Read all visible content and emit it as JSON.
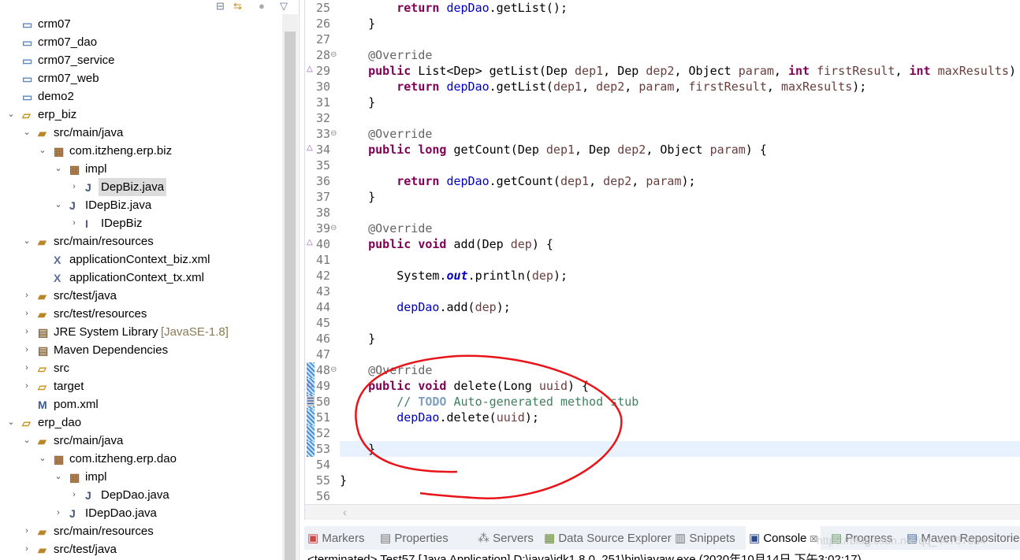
{
  "explorer": {
    "toolbar": {
      "collapse_icon": "collapse-all-icon",
      "link_icon": "link-with-editor-icon",
      "menu_icon": "view-menu-icon"
    },
    "items": [
      {
        "label": "crm07",
        "icon": "folder",
        "depth": 0,
        "chev": ""
      },
      {
        "label": "crm07_dao",
        "icon": "folder",
        "depth": 0,
        "chev": ""
      },
      {
        "label": "crm07_service",
        "icon": "folder",
        "depth": 0,
        "chev": ""
      },
      {
        "label": "crm07_web",
        "icon": "folder",
        "depth": 0,
        "chev": ""
      },
      {
        "label": "demo2",
        "icon": "folder",
        "depth": 0,
        "chev": ""
      },
      {
        "label": "erp_biz",
        "icon": "maven-project",
        "depth": 0,
        "chev": "open"
      },
      {
        "label": "src/main/java",
        "icon": "source-folder",
        "depth": 1,
        "chev": "open"
      },
      {
        "label": "com.itzheng.erp.biz",
        "icon": "package",
        "depth": 2,
        "chev": "open"
      },
      {
        "label": "impl",
        "icon": "package",
        "depth": 3,
        "chev": "open"
      },
      {
        "label": "DepBiz.java",
        "icon": "java-file",
        "depth": 4,
        "chev": "closed",
        "selected": true
      },
      {
        "label": "IDepBiz.java",
        "icon": "java-file",
        "depth": 3,
        "chev": "open"
      },
      {
        "label": "IDepBiz",
        "icon": "interface",
        "depth": 4,
        "chev": "closed"
      },
      {
        "label": "src/main/resources",
        "icon": "source-folder",
        "depth": 1,
        "chev": "open"
      },
      {
        "label": "applicationContext_biz.xml",
        "icon": "xml-file",
        "depth": 2,
        "chev": ""
      },
      {
        "label": "applicationContext_tx.xml",
        "icon": "xml-file",
        "depth": 2,
        "chev": ""
      },
      {
        "label": "src/test/java",
        "icon": "source-folder",
        "depth": 1,
        "chev": "closed"
      },
      {
        "label": "src/test/resources",
        "icon": "source-folder",
        "depth": 1,
        "chev": "closed"
      },
      {
        "label": "JRE System Library",
        "deco": "[JavaSE-1.8]",
        "icon": "library",
        "depth": 1,
        "chev": "closed"
      },
      {
        "label": "Maven Dependencies",
        "icon": "library",
        "depth": 1,
        "chev": "closed"
      },
      {
        "label": "src",
        "icon": "folder-open",
        "depth": 1,
        "chev": "closed"
      },
      {
        "label": "target",
        "icon": "folder-open",
        "depth": 1,
        "chev": "closed"
      },
      {
        "label": "pom.xml",
        "icon": "pom-file",
        "depth": 1,
        "chev": ""
      },
      {
        "label": "erp_dao",
        "icon": "maven-project",
        "depth": 0,
        "chev": "open"
      },
      {
        "label": "src/main/java",
        "icon": "source-folder",
        "depth": 1,
        "chev": "open"
      },
      {
        "label": "com.itzheng.erp.dao",
        "icon": "package",
        "depth": 2,
        "chev": "open"
      },
      {
        "label": "impl",
        "icon": "package",
        "depth": 3,
        "chev": "open"
      },
      {
        "label": "DepDao.java",
        "icon": "java-file",
        "depth": 4,
        "chev": "closed"
      },
      {
        "label": "IDepDao.java",
        "icon": "java-file",
        "depth": 3,
        "chev": "closed"
      },
      {
        "label": "src/main/resources",
        "icon": "source-folder",
        "depth": 1,
        "chev": "closed"
      },
      {
        "label": "src/test/java",
        "icon": "source-folder",
        "depth": 1,
        "chev": "closed"
      }
    ]
  },
  "editor": {
    "current_line": 53,
    "lines": [
      {
        "n": "25",
        "tokens": [
          [
            "        ",
            ""
          ],
          [
            "return",
            "k"
          ],
          [
            " ",
            ""
          ],
          [
            "depDao",
            "f"
          ],
          [
            ".getList();",
            ""
          ]
        ]
      },
      {
        "n": "26",
        "tokens": [
          [
            "    }",
            ""
          ]
        ]
      },
      {
        "n": "27",
        "tokens": []
      },
      {
        "n": "28",
        "fold": true,
        "tokens": [
          [
            "    ",
            ""
          ],
          [
            "@Override",
            "a"
          ]
        ]
      },
      {
        "n": "29",
        "override": true,
        "tokens": [
          [
            "    ",
            ""
          ],
          [
            "public",
            "k"
          ],
          [
            " List<Dep> getList(Dep ",
            ""
          ],
          [
            "dep1",
            "p"
          ],
          [
            ", Dep ",
            ""
          ],
          [
            "dep2",
            "p"
          ],
          [
            ", Object ",
            ""
          ],
          [
            "param",
            "p"
          ],
          [
            ", ",
            ""
          ],
          [
            "int",
            "k"
          ],
          [
            " ",
            ""
          ],
          [
            "firstResult",
            "p"
          ],
          [
            ", ",
            ""
          ],
          [
            "int",
            "k"
          ],
          [
            " ",
            ""
          ],
          [
            "maxResults",
            "p"
          ],
          [
            ")",
            ""
          ]
        ]
      },
      {
        "n": "30",
        "tokens": [
          [
            "        ",
            ""
          ],
          [
            "return",
            "k"
          ],
          [
            " ",
            ""
          ],
          [
            "depDao",
            "f"
          ],
          [
            ".getList(",
            ""
          ],
          [
            "dep1",
            "p"
          ],
          [
            ", ",
            ""
          ],
          [
            "dep2",
            "p"
          ],
          [
            ", ",
            ""
          ],
          [
            "param",
            "p"
          ],
          [
            ", ",
            ""
          ],
          [
            "firstResult",
            "p"
          ],
          [
            ", ",
            ""
          ],
          [
            "maxResults",
            "p"
          ],
          [
            ");",
            ""
          ]
        ]
      },
      {
        "n": "31",
        "tokens": [
          [
            "    }",
            ""
          ]
        ]
      },
      {
        "n": "32",
        "tokens": []
      },
      {
        "n": "33",
        "fold": true,
        "tokens": [
          [
            "    ",
            ""
          ],
          [
            "@Override",
            "a"
          ]
        ]
      },
      {
        "n": "34",
        "override": true,
        "tokens": [
          [
            "    ",
            ""
          ],
          [
            "public",
            "k"
          ],
          [
            " ",
            ""
          ],
          [
            "long",
            "k"
          ],
          [
            " getCount(Dep ",
            ""
          ],
          [
            "dep1",
            "p"
          ],
          [
            ", Dep ",
            ""
          ],
          [
            "dep2",
            "p"
          ],
          [
            ", Object ",
            ""
          ],
          [
            "param",
            "p"
          ],
          [
            ") {",
            ""
          ]
        ]
      },
      {
        "n": "35",
        "tokens": []
      },
      {
        "n": "36",
        "tokens": [
          [
            "        ",
            ""
          ],
          [
            "return",
            "k"
          ],
          [
            " ",
            ""
          ],
          [
            "depDao",
            "f"
          ],
          [
            ".getCount(",
            ""
          ],
          [
            "dep1",
            "p"
          ],
          [
            ", ",
            ""
          ],
          [
            "dep2",
            "p"
          ],
          [
            ", ",
            ""
          ],
          [
            "param",
            "p"
          ],
          [
            ");",
            ""
          ]
        ]
      },
      {
        "n": "37",
        "tokens": [
          [
            "    }",
            ""
          ]
        ]
      },
      {
        "n": "38",
        "tokens": []
      },
      {
        "n": "39",
        "fold": true,
        "tokens": [
          [
            "    ",
            ""
          ],
          [
            "@Override",
            "a"
          ]
        ]
      },
      {
        "n": "40",
        "override": true,
        "tokens": [
          [
            "    ",
            ""
          ],
          [
            "public",
            "k"
          ],
          [
            " ",
            ""
          ],
          [
            "void",
            "k"
          ],
          [
            " add(Dep ",
            ""
          ],
          [
            "dep",
            "p"
          ],
          [
            ") {",
            ""
          ]
        ]
      },
      {
        "n": "41",
        "tokens": []
      },
      {
        "n": "42",
        "tokens": [
          [
            "        System.",
            ""
          ],
          [
            "out",
            "s"
          ],
          [
            ".println(",
            ""
          ],
          [
            "dep",
            "p"
          ],
          [
            ");",
            ""
          ]
        ]
      },
      {
        "n": "43",
        "tokens": []
      },
      {
        "n": "44",
        "tokens": [
          [
            "        ",
            ""
          ],
          [
            "depDao",
            "f"
          ],
          [
            ".add(",
            ""
          ],
          [
            "dep",
            "p"
          ],
          [
            ");",
            ""
          ]
        ]
      },
      {
        "n": "45",
        "tokens": []
      },
      {
        "n": "46",
        "tokens": [
          [
            "    }",
            ""
          ]
        ]
      },
      {
        "n": "47",
        "tokens": []
      },
      {
        "n": "48",
        "fold": true,
        "changed": true,
        "tokens": [
          [
            "    ",
            ""
          ],
          [
            "@Override",
            "a"
          ]
        ]
      },
      {
        "n": "49",
        "override": true,
        "changed": true,
        "tokens": [
          [
            "    ",
            ""
          ],
          [
            "public",
            "k"
          ],
          [
            " ",
            ""
          ],
          [
            "void",
            "k"
          ],
          [
            " delete(Long ",
            ""
          ],
          [
            "uuid",
            "p"
          ],
          [
            ") {",
            ""
          ]
        ]
      },
      {
        "n": "50",
        "task": true,
        "changed": true,
        "tokens": [
          [
            "        ",
            ""
          ],
          [
            "// ",
            "c"
          ],
          [
            "TODO",
            "t"
          ],
          [
            " Auto-generated method stub",
            "c"
          ]
        ]
      },
      {
        "n": "51",
        "changed": true,
        "tokens": [
          [
            "        ",
            ""
          ],
          [
            "depDao",
            "f"
          ],
          [
            ".delete(",
            ""
          ],
          [
            "uuid",
            "p"
          ],
          [
            ");",
            ""
          ]
        ]
      },
      {
        "n": "52",
        "changed": true,
        "tokens": []
      },
      {
        "n": "53",
        "changed": true,
        "tokens": [
          [
            "    }",
            ""
          ]
        ]
      },
      {
        "n": "54",
        "tokens": []
      },
      {
        "n": "55",
        "tokens": [
          [
            "}",
            ""
          ]
        ]
      },
      {
        "n": "56",
        "tokens": []
      }
    ]
  },
  "bottom": {
    "tabs": [
      {
        "label": "Markers",
        "icon": "markers-icon"
      },
      {
        "label": "Properties",
        "icon": "properties-icon"
      },
      {
        "label": "Servers",
        "icon": "servers-icon"
      },
      {
        "label": "Data Source Explorer",
        "icon": "data-source-icon"
      },
      {
        "label": "Snippets",
        "icon": "snippets-icon"
      },
      {
        "label": "Console",
        "icon": "console-icon",
        "active": true,
        "close": "☒"
      },
      {
        "label": "Progress",
        "icon": "progress-icon"
      },
      {
        "label": "Maven Repositorie",
        "icon": "maven-repo-icon"
      }
    ],
    "console_line": "<terminated> Test57 [Java Application] D:\\java\\jdk1.8.0_251\\bin\\javaw.exe (2020年10月14日 下午3:02:17)",
    "watermark": "https://blog.csdn.net/qq_44757034"
  },
  "colors": {
    "annotation": "#e8141a",
    "keyword": "#7f0055",
    "field": "#0000c0",
    "comment": "#3f7f5f"
  }
}
